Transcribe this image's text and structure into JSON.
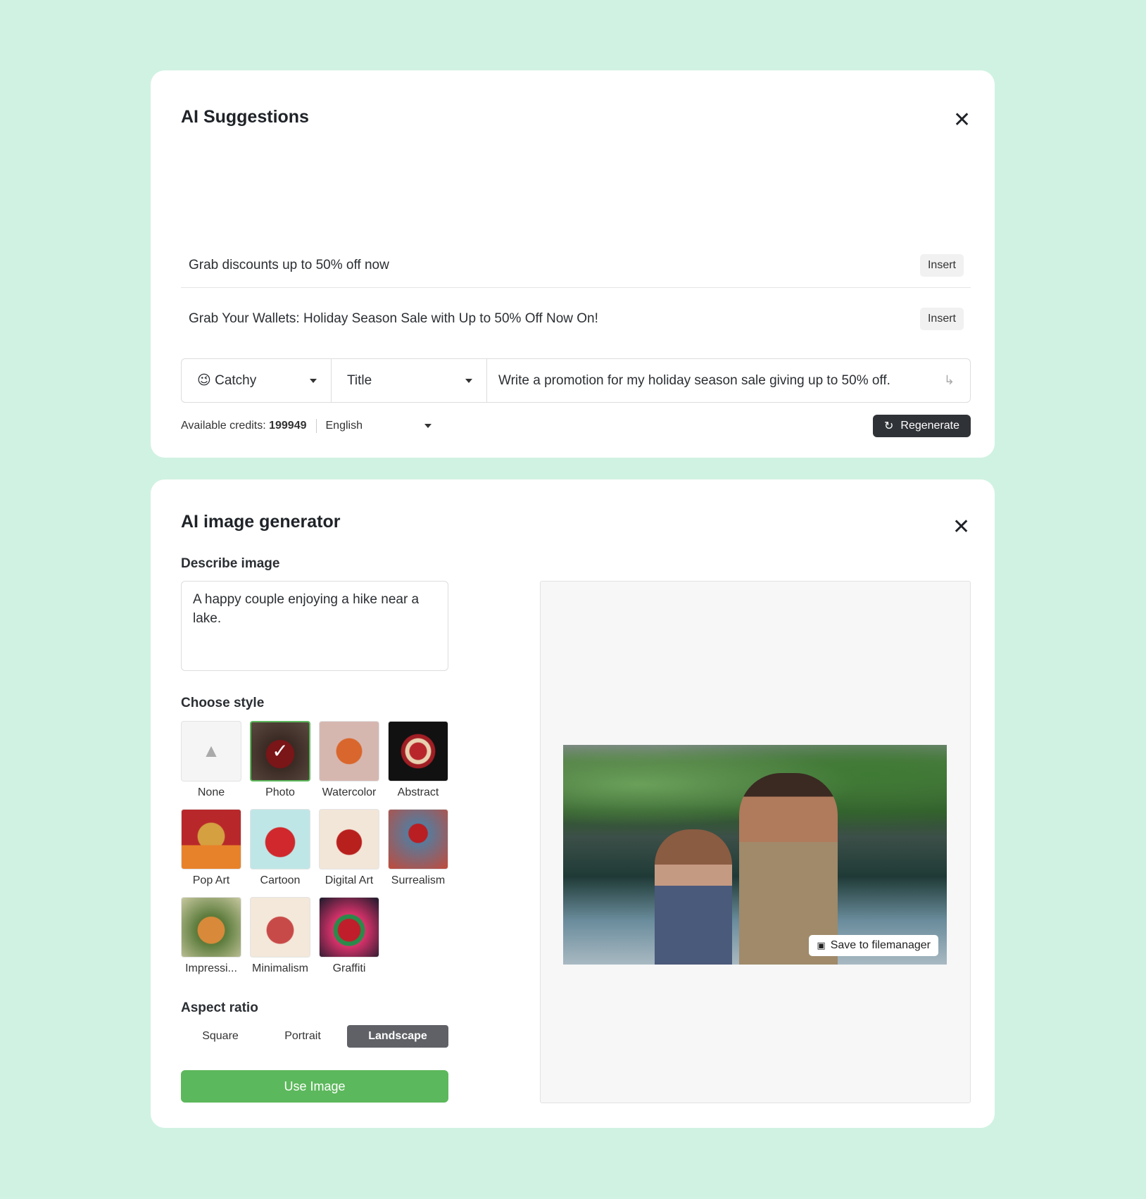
{
  "suggestions": {
    "title": "AI Suggestions",
    "items": [
      {
        "text": "Grab discounts up to 50% off now",
        "action": "Insert"
      },
      {
        "text": "Grab Your Wallets: Holiday Season Sale with Up to 50% Off Now On!",
        "action": "Insert"
      }
    ],
    "tone": {
      "emoji": "😉",
      "value": "Catchy"
    },
    "format": {
      "value": "Title"
    },
    "prompt": "Write a promotion for my holiday season sale giving up to 50% off.",
    "credits_label": "Available credits:",
    "credits_value": "199949",
    "language": "English",
    "regenerate": "Regenerate"
  },
  "generator": {
    "title": "AI image generator",
    "describe_label": "Describe image",
    "description": "A happy couple enjoying a hike near a lake.",
    "style_label": "Choose style",
    "styles": [
      {
        "name": "None"
      },
      {
        "name": "Photo",
        "selected": true
      },
      {
        "name": "Watercolor"
      },
      {
        "name": "Abstract"
      },
      {
        "name": "Pop Art"
      },
      {
        "name": "Cartoon"
      },
      {
        "name": "Digital Art"
      },
      {
        "name": "Surrealism"
      },
      {
        "name": "Impressi..."
      },
      {
        "name": "Minimalism"
      },
      {
        "name": "Graffiti"
      }
    ],
    "aspect_label": "Aspect ratio",
    "aspect_options": [
      "Square",
      "Portrait",
      "Landscape"
    ],
    "aspect_selected": "Landscape",
    "use_image": "Use Image",
    "save_to_filemanager": "Save to filemanager"
  },
  "colors": {
    "background": "#d0f2e2",
    "primary": "#5cb85c",
    "dark_button": "#2f3237",
    "selected_aspect": "#5f6166"
  }
}
